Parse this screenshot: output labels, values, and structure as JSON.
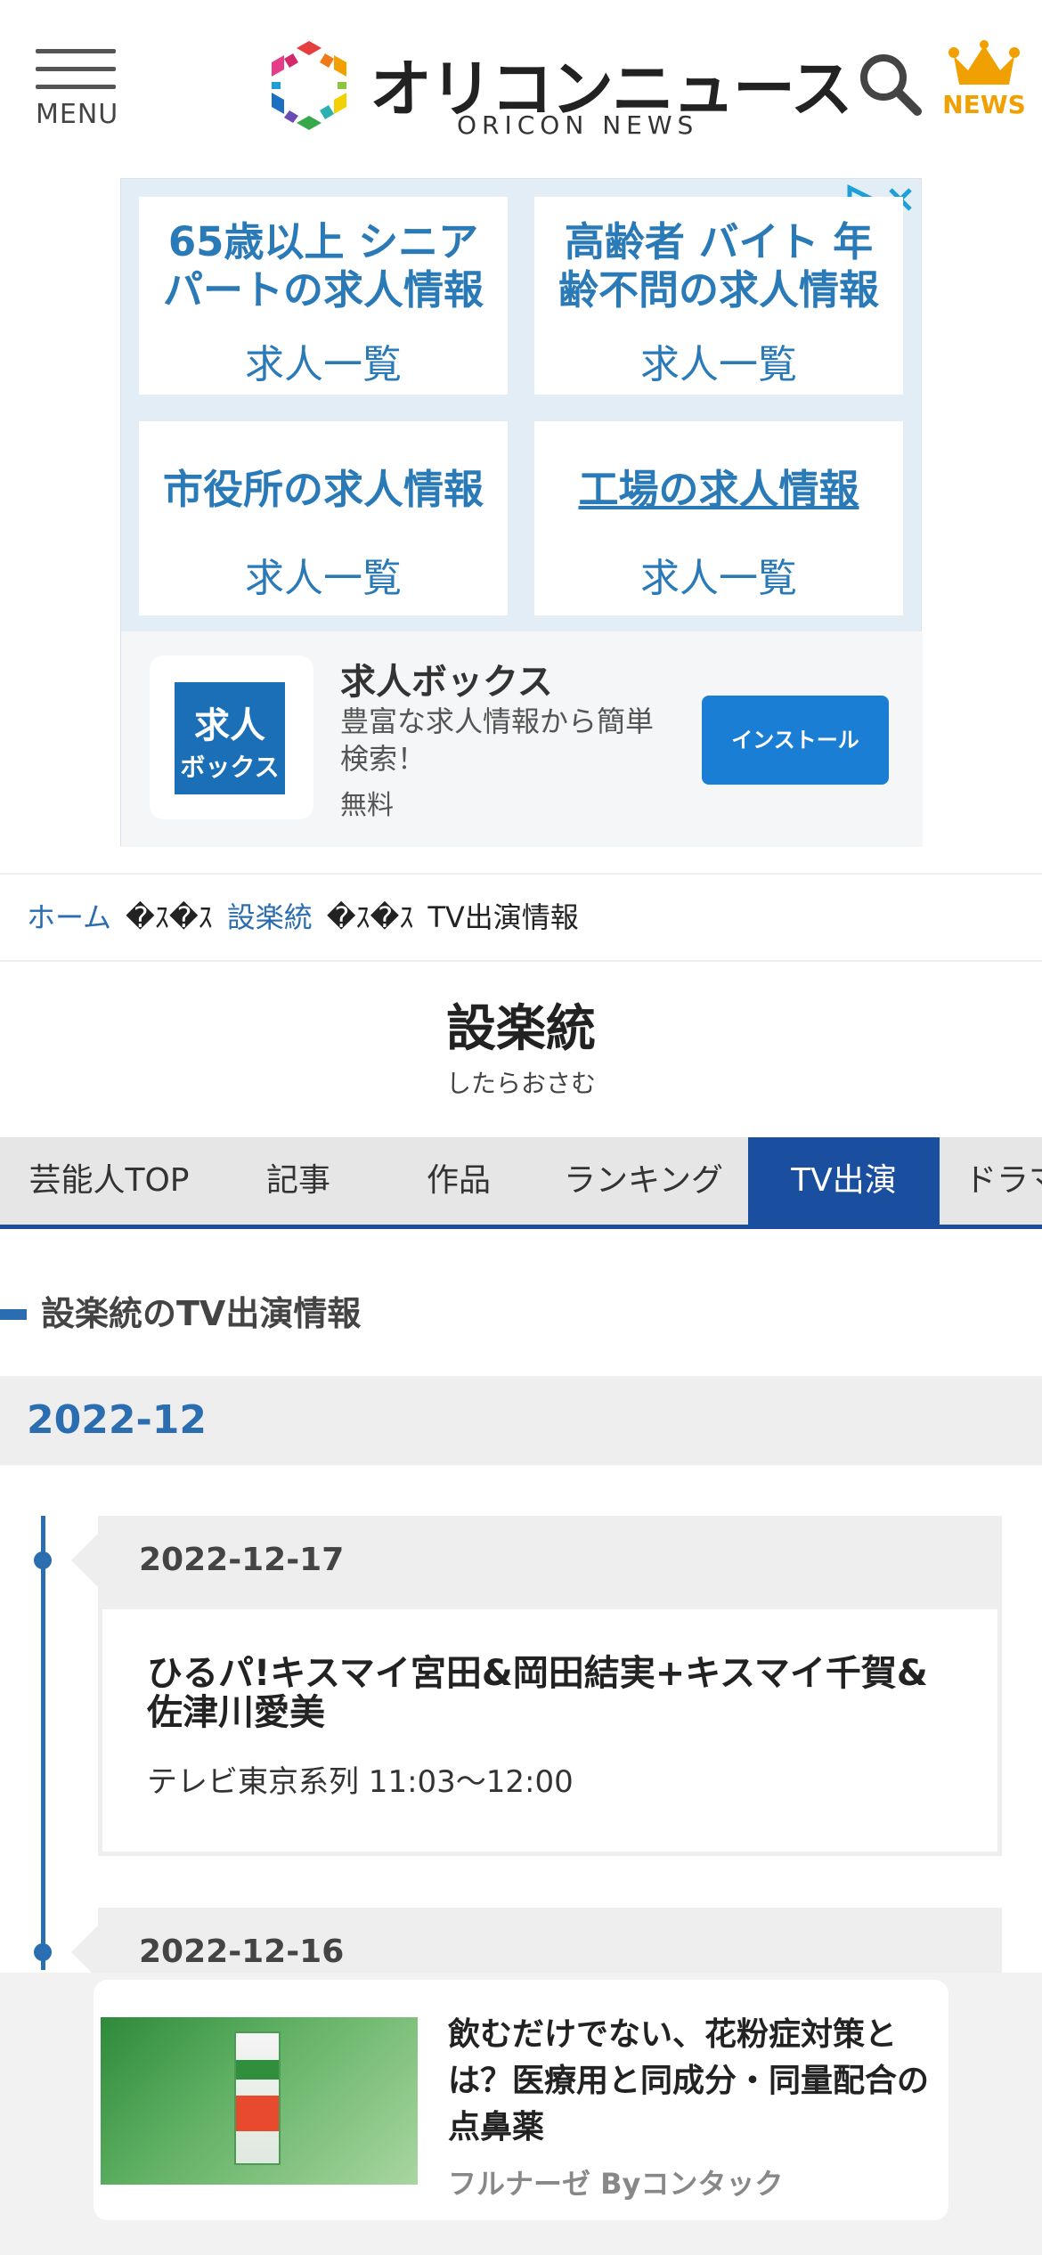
{
  "header": {
    "menu_label": "MENU",
    "logo_jp": "オリコンニュース",
    "logo_en": "ORICON NEWS",
    "news_label": "NEWS"
  },
  "ad": {
    "cells": [
      {
        "title": "65歳以上 シニアパートの求人情報",
        "sub": "求人一覧"
      },
      {
        "title": "高齢者 バイト 年齢不問の求人情報",
        "sub": "求人一覧"
      },
      {
        "title": "市役所の求人情報",
        "sub": "求人一覧"
      },
      {
        "title": "工場の求人情報",
        "sub": "求人一覧"
      }
    ],
    "app": {
      "icon_line1": "求人",
      "icon_line2": "ボックス",
      "name": "求人ボックス",
      "desc": "豊富な求人情報から簡単検索！",
      "price": "無料",
      "install": "インストール"
    }
  },
  "breadcrumb": {
    "home": "ホーム",
    "sep1": "�ｽ�ｽ",
    "artist": "設楽統",
    "sep2": "�ｽ�ｽ",
    "current": "TV出演情報"
  },
  "artist": {
    "name": "設楽統",
    "kana": "したらおさむ"
  },
  "tabs": [
    {
      "label": "芸能人TOP"
    },
    {
      "label": "記事"
    },
    {
      "label": "作品"
    },
    {
      "label": "ランキング"
    },
    {
      "label": "TV出演"
    },
    {
      "label": "ドラマ"
    }
  ],
  "section": {
    "heading": "設楽統のTV出演情報",
    "month": "2022-12"
  },
  "timeline": [
    {
      "date": "2022-12-17",
      "program_title": "ひるパ!キスマイ宮田&岡田結実+キスマイ千賀&佐津川愛美",
      "program_info": "テレビ東京系列 11:03〜12:00"
    },
    {
      "date": "2022-12-16"
    }
  ],
  "bottom_ad": {
    "title": "飲むだけでない、花粉症対策とは？医療用と同成分・同量配合の点鼻薬",
    "sponsor": "フルナーゼ Byコンタック"
  },
  "colors": {
    "accent_blue": "#1a4fa0",
    "link_blue": "#2a6db1",
    "news_orange": "#f0a000"
  }
}
